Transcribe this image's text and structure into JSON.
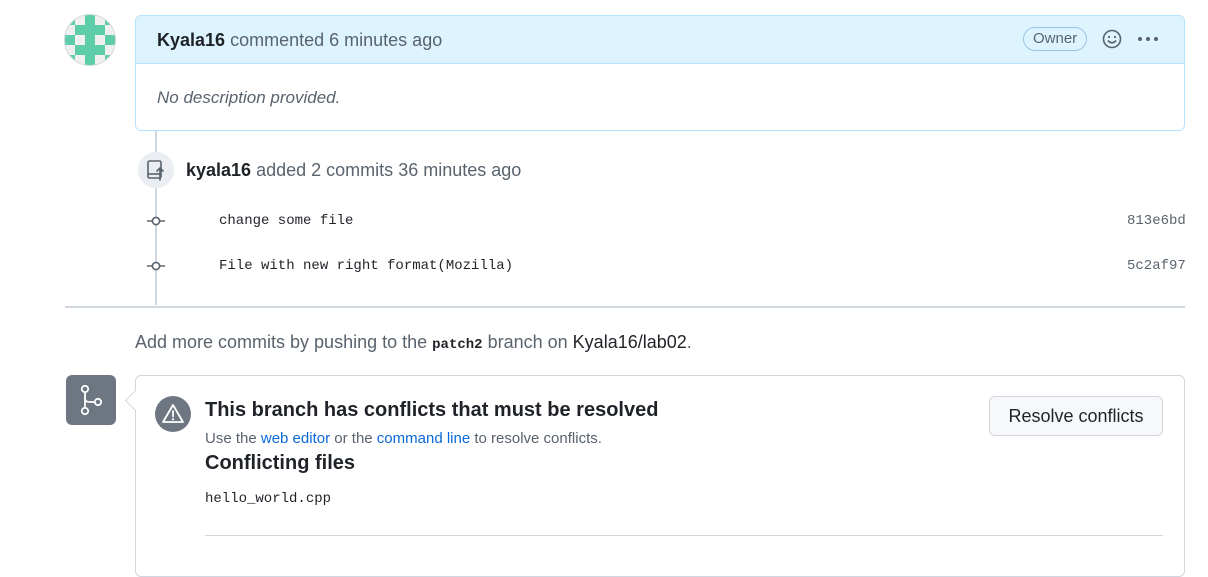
{
  "comment": {
    "author": "Kyala16",
    "action": "commented",
    "time": "6 minutes ago",
    "badge": "Owner",
    "body": "No description provided."
  },
  "push": {
    "user": "kyala16",
    "text": "added 2 commits",
    "time": "36 minutes ago"
  },
  "commits": [
    {
      "message": "change some file",
      "sha": "813e6bd"
    },
    {
      "message": "File with new right format(Mozilla)",
      "sha": "5c2af97"
    }
  ],
  "hint": {
    "prefix": "Add more commits by pushing to the",
    "branch": "patch2",
    "middle": "branch on",
    "repo": "Kyala16/lab02",
    "suffix": "."
  },
  "merge": {
    "title": "This branch has conflicts that must be resolved",
    "sub_prefix": "Use the",
    "web_editor_link": "web editor",
    "sub_middle": "or the",
    "command_line_link": "command line",
    "sub_suffix": "to resolve conflicts.",
    "resolve_button": "Resolve conflicts",
    "files_title": "Conflicting files",
    "files": [
      "hello_world.cpp"
    ]
  },
  "colors": {
    "accent_link": "#0969da",
    "comment_header": "#ddf4ff",
    "icon_bg": "#6e7781"
  }
}
